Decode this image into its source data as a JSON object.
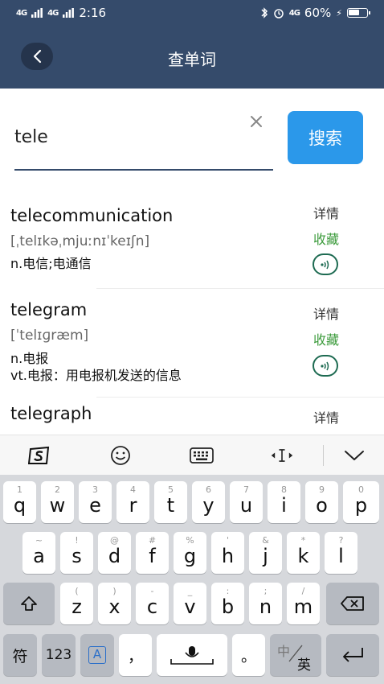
{
  "status_bar": {
    "signal1": "4G",
    "signal2": "4G",
    "time": "2:16",
    "network": "4G",
    "battery_text": "60%",
    "battery_level": 0.6
  },
  "header": {
    "title": "查单词"
  },
  "search": {
    "value": "tele",
    "button_label": "搜索"
  },
  "results": [
    {
      "word": "telecommunication",
      "phonetic": "[ˌtelɪkəˌmjuːnɪˈkeɪʃn]",
      "definitions": [
        "n.电信;电通信"
      ],
      "detail_label": "详情",
      "collect_label": "收藏"
    },
    {
      "word": "telegram",
      "phonetic": "[ˈtelɪɡræm]",
      "definitions": [
        "n.电报",
        "vt.电报：用电报机发送的信息"
      ],
      "detail_label": "详情",
      "collect_label": "收藏"
    },
    {
      "word": "telegraph",
      "detail_label": "详情"
    }
  ],
  "keyboard": {
    "row1": [
      {
        "hint": "1",
        "key": "q"
      },
      {
        "hint": "2",
        "key": "w"
      },
      {
        "hint": "3",
        "key": "e"
      },
      {
        "hint": "4",
        "key": "r"
      },
      {
        "hint": "5",
        "key": "t"
      },
      {
        "hint": "6",
        "key": "y"
      },
      {
        "hint": "7",
        "key": "u"
      },
      {
        "hint": "8",
        "key": "i"
      },
      {
        "hint": "9",
        "key": "o"
      },
      {
        "hint": "0",
        "key": "p"
      }
    ],
    "row2": [
      {
        "hint": "~",
        "key": "a"
      },
      {
        "hint": "!",
        "key": "s"
      },
      {
        "hint": "@",
        "key": "d"
      },
      {
        "hint": "#",
        "key": "f"
      },
      {
        "hint": "%",
        "key": "g"
      },
      {
        "hint": "'",
        "key": "h"
      },
      {
        "hint": "&",
        "key": "j"
      },
      {
        "hint": "*",
        "key": "k"
      },
      {
        "hint": "?",
        "key": "l"
      }
    ],
    "row3": [
      {
        "hint": "(",
        "key": "z"
      },
      {
        "hint": ")",
        "key": "x"
      },
      {
        "hint": "-",
        "key": "c"
      },
      {
        "hint": "_",
        "key": "v"
      },
      {
        "hint": ":",
        "key": "b"
      },
      {
        "hint": ";",
        "key": "n"
      },
      {
        "hint": "/",
        "key": "m"
      }
    ],
    "symbols_label": "符",
    "numbers_label": "123",
    "caps_label": "A",
    "comma_label": "，",
    "period_label": "。",
    "lang_label_cn": "中",
    "lang_label_en": "英"
  },
  "icons": {
    "back": "chevron-left-icon",
    "clear": "close-icon",
    "play": "speaker-icon",
    "shift": "shift-icon",
    "backspace": "backspace-icon",
    "enter": "enter-icon"
  },
  "colors": {
    "header_bg": "#354b6b",
    "search_button": "#2b98ea",
    "collect_text": "#3a9a3a",
    "play_border": "#1e6b52"
  }
}
